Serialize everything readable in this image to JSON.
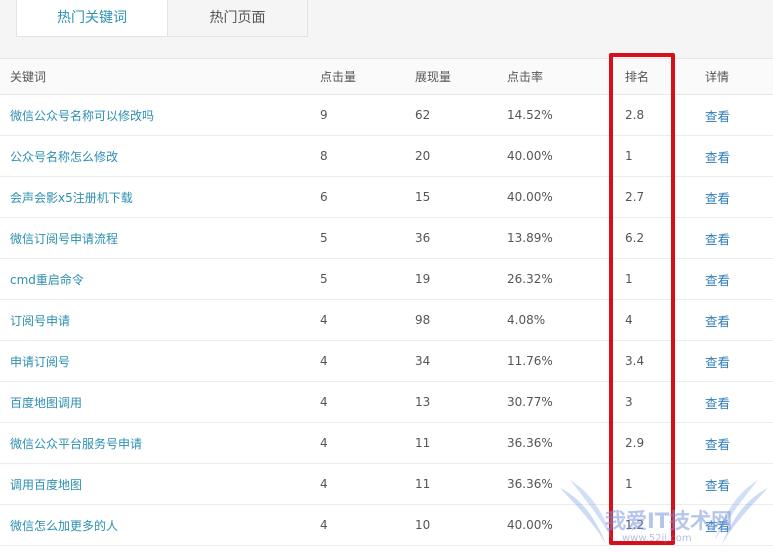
{
  "tabs": [
    {
      "label": "热门关键词",
      "active": true
    },
    {
      "label": "热门页面",
      "active": false
    }
  ],
  "table": {
    "headers": [
      "关键词",
      "点击量",
      "展现量",
      "点击率",
      "排名",
      "详情"
    ],
    "rows": [
      {
        "keyword": "微信公众号名称可以修改吗",
        "clicks": "9",
        "impressions": "62",
        "ctr": "14.52%",
        "rank": "2.8",
        "detail": "查看"
      },
      {
        "keyword": "公众号名称怎么修改",
        "clicks": "8",
        "impressions": "20",
        "ctr": "40.00%",
        "rank": "1",
        "detail": "查看"
      },
      {
        "keyword": "会声会影x5注册机下载",
        "clicks": "6",
        "impressions": "15",
        "ctr": "40.00%",
        "rank": "2.7",
        "detail": "查看"
      },
      {
        "keyword": "微信订阅号申请流程",
        "clicks": "5",
        "impressions": "36",
        "ctr": "13.89%",
        "rank": "6.2",
        "detail": "查看"
      },
      {
        "keyword": "cmd重启命令",
        "clicks": "5",
        "impressions": "19",
        "ctr": "26.32%",
        "rank": "1",
        "detail": "查看"
      },
      {
        "keyword": "订阅号申请",
        "clicks": "4",
        "impressions": "98",
        "ctr": "4.08%",
        "rank": "4",
        "detail": "查看"
      },
      {
        "keyword": "申请订阅号",
        "clicks": "4",
        "impressions": "34",
        "ctr": "11.76%",
        "rank": "3.4",
        "detail": "查看"
      },
      {
        "keyword": "百度地图调用",
        "clicks": "4",
        "impressions": "13",
        "ctr": "30.77%",
        "rank": "3",
        "detail": "查看"
      },
      {
        "keyword": "微信公众平台服务号申请",
        "clicks": "4",
        "impressions": "11",
        "ctr": "36.36%",
        "rank": "2.9",
        "detail": "查看"
      },
      {
        "keyword": "调用百度地图",
        "clicks": "4",
        "impressions": "11",
        "ctr": "36.36%",
        "rank": "1",
        "detail": "查看"
      },
      {
        "keyword": "微信怎么加更多的人",
        "clicks": "4",
        "impressions": "10",
        "ctr": "40.00%",
        "rank": "1.2",
        "detail": "查看"
      }
    ]
  },
  "annotation": {
    "color": "#d6101a",
    "target_column": "排名"
  },
  "watermark": {
    "text": "我爱IT技术网",
    "url": "www.52ij.com"
  },
  "colors": {
    "keyword_link": "#2c8fb0",
    "detail_link": "#2f7db8",
    "active_tab": "#2c93b3"
  }
}
